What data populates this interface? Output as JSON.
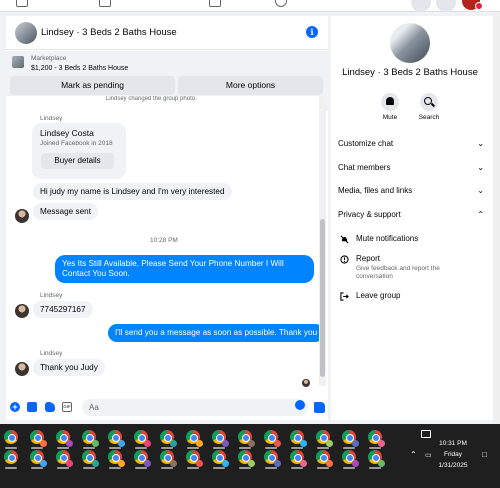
{
  "chat": {
    "header_title": "Lindsey · 3 Beds 2 Baths House",
    "info_icon": "i",
    "marketplace_label": "Marketplace",
    "listing": "$1,200 - 3 Beds 2 Baths House",
    "mark_pending_label": "Mark as pending",
    "more_options_label": "More options",
    "cut_off_line": "Lindsey changed the group photo.",
    "card_sender": "Lindsey",
    "card_name": "Lindsey Costa",
    "card_sub": "Joined Facebook in 2018",
    "card_button": "Buyer details",
    "msg_interest": "Hi judy my name is Lindsey and I'm very interested",
    "msg_sent": "Message sent",
    "time": "10:28 PM",
    "reply_1": "Yes Its Still Available, Please Send Your Phone Number I Will Contact You Soon.",
    "sender_2": "Lindsey",
    "msg_phone": "7745297167",
    "reply_2": "I'll send you a message as soon as possible. Thank you",
    "sender_3": "Lindsey",
    "msg_thanks": "Thank you Judy",
    "composer_placeholder": "Aa",
    "gif_label": "GIF",
    "plus_label": "+"
  },
  "info": {
    "name": "Lindsey · 3 Beds 2 Baths House",
    "mute_label": "Mute",
    "search_label": "Search",
    "rows": {
      "customize": "Customize chat",
      "members": "Chat members",
      "media": "Media, files and links",
      "privacy": "Privacy & support"
    },
    "privacy_items": {
      "mute": "Mute notifications",
      "report": "Report",
      "report_desc": "Give feedback and report the conversation",
      "leave": "Leave group"
    }
  },
  "taskbar": {
    "time": "10:31 PM",
    "day": "Friday",
    "date": "1/31/2025"
  },
  "colors": {
    "accent": "#0866ff",
    "outgoing_bubble": "#0084ff",
    "incoming_bubble": "#f0f2f5",
    "taskbar": "#1f1f1f"
  }
}
